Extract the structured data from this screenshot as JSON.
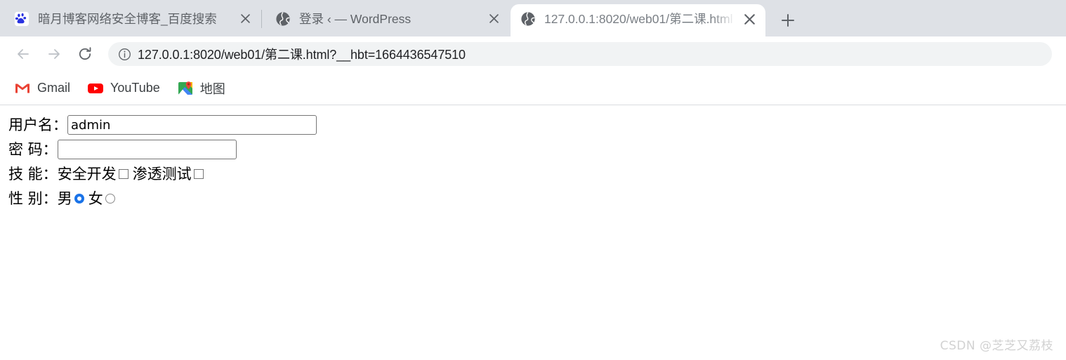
{
  "browser": {
    "tabs": [
      {
        "title": "暗月博客网络安全博客_百度搜索",
        "favicon": "baidu-paw-icon",
        "active": false,
        "close_label": "×"
      },
      {
        "title": "登录 ‹ — WordPress",
        "favicon": "globe-icon",
        "active": false,
        "close_label": "×"
      },
      {
        "title": "127.0.0.1:8020/web01/第二课.html",
        "favicon": "globe-icon",
        "active": true,
        "close_label": "×"
      }
    ],
    "newtab_label": "+",
    "toolbar": {
      "back_label": "←",
      "forward_label": "→",
      "reload_label": "⟳",
      "site_info_icon": "info-circle-icon",
      "url": "127.0.0.1:8020/web01/第二课.html?__hbt=1664436547510"
    },
    "bookmarks": [
      {
        "label": "Gmail",
        "icon": "gmail-icon"
      },
      {
        "label": "YouTube",
        "icon": "youtube-icon"
      },
      {
        "label": "地图",
        "icon": "google-maps-icon"
      }
    ]
  },
  "page": {
    "form": {
      "username": {
        "label": "用户名：",
        "value": "admin",
        "placeholder": ""
      },
      "password": {
        "label": "密 码：",
        "value": "",
        "placeholder": ""
      },
      "skills": {
        "label": "技 能：",
        "options": [
          {
            "text": "安全开发",
            "checked": false
          },
          {
            "text": "渗透测试",
            "checked": false
          }
        ]
      },
      "gender": {
        "label": "性 别：",
        "options": [
          {
            "text": "男",
            "checked": true
          },
          {
            "text": "女",
            "checked": false
          }
        ]
      }
    },
    "watermark": "CSDN @芝芝又荔枝"
  },
  "colors": {
    "tabstrip_bg": "#dee1e6",
    "accent": "#1a73e8",
    "omnibox_bg": "#f1f3f4",
    "text": "#202124"
  }
}
